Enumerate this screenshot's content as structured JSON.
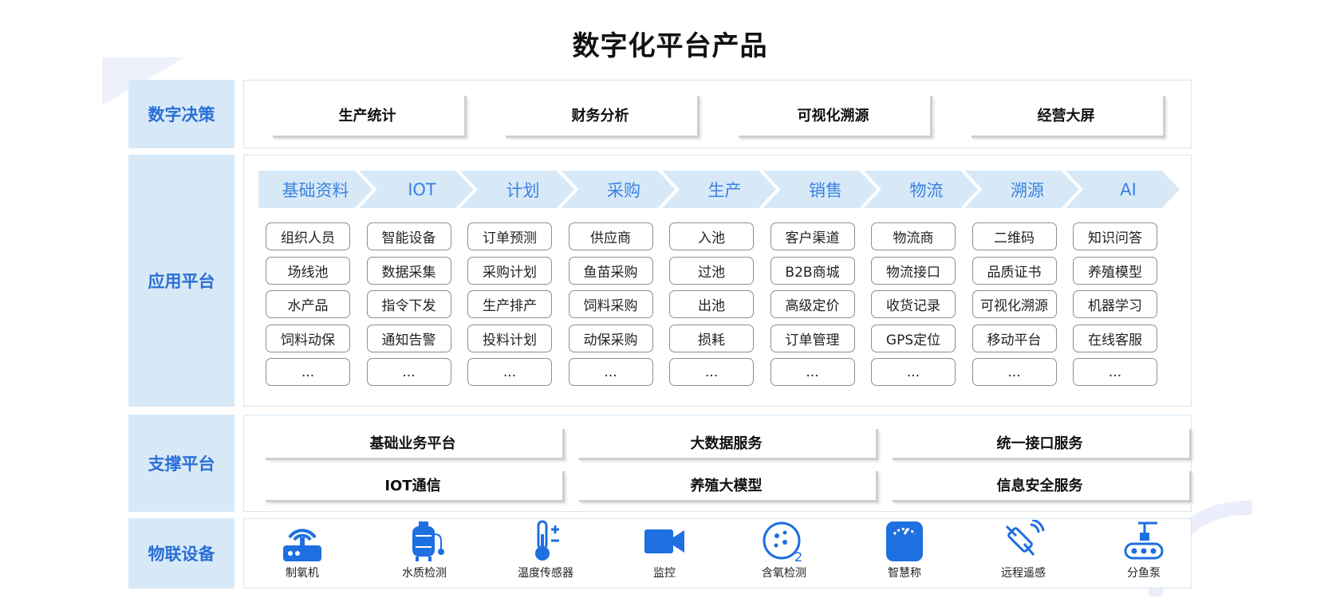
{
  "title": "数字化平台产品",
  "layers": {
    "decision": {
      "label": "数字决策",
      "cards": [
        "生产统计",
        "财务分析",
        "可视化溯源",
        "经营大屏"
      ]
    },
    "application": {
      "label": "应用平台",
      "columns": [
        {
          "header": "基础资料",
          "items": [
            "组织人员",
            "场线池",
            "水产品",
            "饲料动保",
            "..."
          ]
        },
        {
          "header": "IOT",
          "items": [
            "智能设备",
            "数据采集",
            "指令下发",
            "通知告警",
            "..."
          ]
        },
        {
          "header": "计划",
          "items": [
            "订单预测",
            "采购计划",
            "生产排产",
            "投料计划",
            "..."
          ]
        },
        {
          "header": "采购",
          "items": [
            "供应商",
            "鱼苗采购",
            "饲料采购",
            "动保采购",
            "..."
          ]
        },
        {
          "header": "生产",
          "items": [
            "入池",
            "过池",
            "出池",
            "损耗",
            "..."
          ]
        },
        {
          "header": "销售",
          "items": [
            "客户渠道",
            "B2B商城",
            "高级定价",
            "订单管理",
            "..."
          ]
        },
        {
          "header": "物流",
          "items": [
            "物流商",
            "物流接口",
            "收货记录",
            "GPS定位",
            "..."
          ]
        },
        {
          "header": "溯源",
          "items": [
            "二维码",
            "品质证书",
            "可视化溯源",
            "移动平台",
            "..."
          ]
        },
        {
          "header": "AI",
          "items": [
            "知识问答",
            "养殖模型",
            "机器学习",
            "在线客服",
            "..."
          ]
        }
      ]
    },
    "support": {
      "label": "支撑平台",
      "cards": [
        "基础业务平台",
        "大数据服务",
        "统一接口服务",
        "IOT通信",
        "养殖大模型",
        "信息安全服务"
      ]
    },
    "iot": {
      "label": "物联设备",
      "devices": [
        {
          "icon": "router-icon",
          "label": "制氧机"
        },
        {
          "icon": "water-tank-icon",
          "label": "水质检测"
        },
        {
          "icon": "thermometer-icon",
          "label": "温度传感器"
        },
        {
          "icon": "video-camera-icon",
          "label": "监控"
        },
        {
          "icon": "oxygen-sensor-icon",
          "label": "含氧检测"
        },
        {
          "icon": "scale-icon",
          "label": "智慧称"
        },
        {
          "icon": "satellite-icon",
          "label": "远程遥感"
        },
        {
          "icon": "fish-pump-icon",
          "label": "分鱼泵"
        }
      ]
    }
  },
  "colors": {
    "accent": "#2a6fd6",
    "side_bg": "#d7e9f7",
    "icon": "#1e6fe0"
  }
}
